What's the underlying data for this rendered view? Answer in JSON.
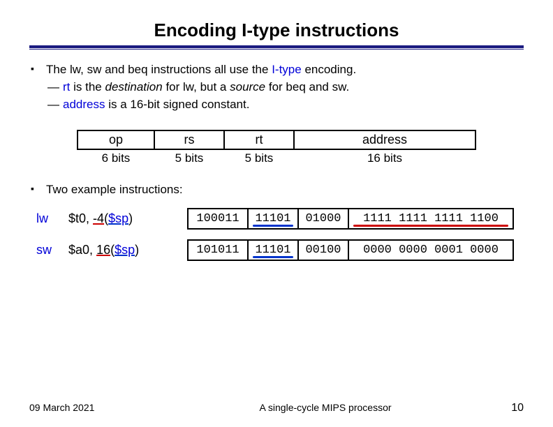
{
  "title": "Encoding I-type instructions",
  "b1_pre": "The lw, sw and beq instructions all use the ",
  "b1_blue": "I-type",
  "b1_post": " encoding.",
  "d1_a": "rt",
  "d1_b": " is the ",
  "d1_c": "destination",
  "d1_d": " for lw, but a ",
  "d1_e": "source",
  "d1_f": " for beq and sw.",
  "d2_a": "address",
  "d2_b": " is a 16-bit signed constant.",
  "fmt": {
    "op": "op",
    "rs": "rs",
    "rt": "rt",
    "addr": "address",
    "op_w": "6 bits",
    "rs_w": "5 bits",
    "rt_w": "5 bits",
    "addr_w": "16 bits"
  },
  "b2": "Two example instructions:",
  "ex1": {
    "mn": "lw",
    "reg": "$t0",
    "sep": ", ",
    "imm": "-4",
    "lp": "(",
    "base": "$sp",
    "rp": ")",
    "op": "100011",
    "rs": "11101",
    "rt": "01000",
    "addr": "1111 1111 1111 1100"
  },
  "ex2": {
    "mn": "sw",
    "reg": "$a0",
    "sep": ", ",
    "imm": "16",
    "lp": "(",
    "base": "$sp",
    "rp": ")",
    "op": "101011",
    "rs": "11101",
    "rt": "00100",
    "addr": "0000 0000 0001 0000"
  },
  "footer": {
    "date": "09 March 2021",
    "mid": "A single-cycle MIPS processor",
    "num": "10"
  }
}
